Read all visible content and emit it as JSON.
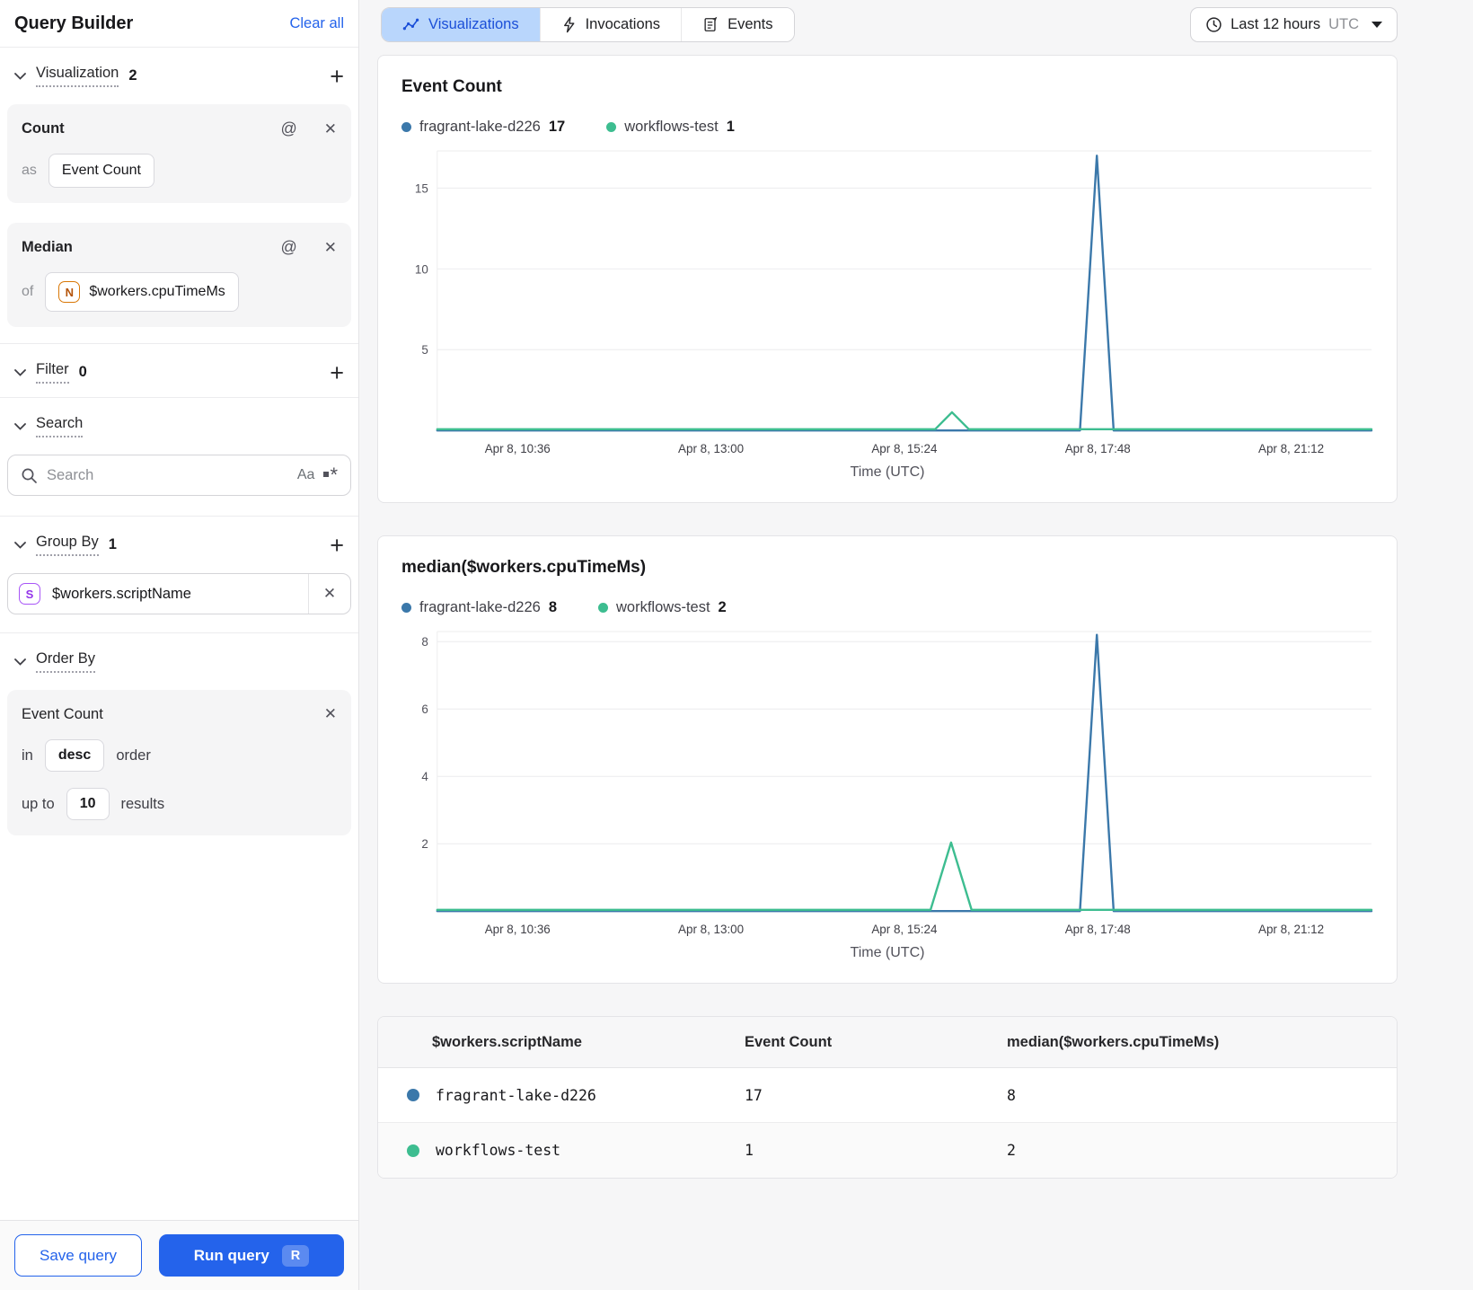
{
  "sidebar": {
    "title": "Query Builder",
    "clear_all": "Clear all",
    "visualization": {
      "label": "Visualization",
      "count": 2,
      "cards": [
        {
          "title": "Count",
          "prefix": "as",
          "value": "Event Count"
        },
        {
          "title": "Median",
          "prefix": "of",
          "badge": "N",
          "value": "$workers.cpuTimeMs"
        }
      ]
    },
    "filter": {
      "label": "Filter",
      "count": 0
    },
    "search": {
      "label": "Search",
      "placeholder": "Search",
      "case_icon": "Aa"
    },
    "group_by": {
      "label": "Group By",
      "count": 1,
      "badge": "S",
      "value": "$workers.scriptName"
    },
    "order_by": {
      "label": "Order By",
      "field": "Event Count",
      "in_label": "in",
      "direction": "desc",
      "order_label": "order",
      "upto_label": "up to",
      "limit": "10",
      "results_label": "results"
    },
    "save_button": "Save query",
    "run_button": "Run query",
    "run_shortcut": "R"
  },
  "topbar": {
    "tabs": [
      {
        "label": "Visualizations",
        "active": true
      },
      {
        "label": "Invocations",
        "active": false
      },
      {
        "label": "Events",
        "active": false
      }
    ],
    "time_range": {
      "label": "Last 12 hours",
      "timezone": "UTC"
    }
  },
  "chart_data": [
    {
      "type": "line",
      "title": "Event Count",
      "xlabel": "Time (UTC)",
      "x_ticks": [
        "Apr 8, 10:36",
        "Apr 8, 13:00",
        "Apr 8, 15:24",
        "Apr 8, 17:48",
        "Apr 8, 21:12"
      ],
      "x_tick_pos": [
        0.086,
        0.293,
        0.5,
        0.707,
        0.914
      ],
      "y_ticks": [
        5,
        10,
        15
      ],
      "ylim": [
        0,
        17.3
      ],
      "grid": true,
      "legend_position": "top",
      "series": [
        {
          "name": "fragrant-lake-d226",
          "total": 17,
          "color": "#3b78aa",
          "points": [
            [
              0,
              0
            ],
            [
              0.688,
              0
            ],
            [
              0.706,
              17
            ],
            [
              0.724,
              0
            ],
            [
              1,
              0
            ]
          ]
        },
        {
          "name": "workflows-test",
          "total": 1,
          "color": "#3dbd90",
          "points": [
            [
              0,
              0
            ],
            [
              0.533,
              0
            ],
            [
              0.551,
              1.05
            ],
            [
              0.569,
              0
            ],
            [
              1,
              0
            ]
          ]
        }
      ]
    },
    {
      "type": "line",
      "title": "median($workers.cpuTimeMs)",
      "xlabel": "Time (UTC)",
      "x_ticks": [
        "Apr 8, 10:36",
        "Apr 8, 13:00",
        "Apr 8, 15:24",
        "Apr 8, 17:48",
        "Apr 8, 21:12"
      ],
      "x_tick_pos": [
        0.086,
        0.293,
        0.5,
        0.707,
        0.914
      ],
      "y_ticks": [
        2,
        4,
        6,
        8
      ],
      "ylim": [
        0,
        8.3
      ],
      "grid": true,
      "legend_position": "top",
      "series": [
        {
          "name": "fragrant-lake-d226",
          "total": 8,
          "color": "#3b78aa",
          "points": [
            [
              0,
              0
            ],
            [
              0.688,
              0
            ],
            [
              0.706,
              8.2
            ],
            [
              0.724,
              0
            ],
            [
              1,
              0
            ]
          ]
        },
        {
          "name": "workflows-test",
          "total": 2,
          "color": "#3dbd90",
          "points": [
            [
              0,
              0
            ],
            [
              0.528,
              0
            ],
            [
              0.55,
              2
            ],
            [
              0.572,
              0
            ],
            [
              1,
              0
            ]
          ]
        }
      ]
    }
  ],
  "table": {
    "columns": [
      "$workers.scriptName",
      "Event Count",
      "median($workers.cpuTimeMs)"
    ],
    "rows": [
      {
        "color": "#3b78aa",
        "name": "fragrant-lake-d226",
        "event_count": "17",
        "median": "8"
      },
      {
        "color": "#3dbd90",
        "name": "workflows-test",
        "event_count": "1",
        "median": "2"
      }
    ]
  },
  "colors": {
    "accent_blue": "#2463eb",
    "series_blue": "#3b78aa",
    "series_green": "#3dbd90",
    "active_tab_bg": "#b9d6fc"
  }
}
